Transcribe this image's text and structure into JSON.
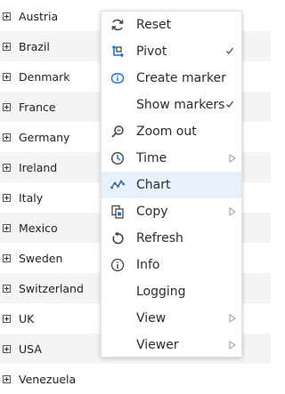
{
  "countries": [
    "Austria",
    "Brazil",
    "Denmark",
    "France",
    "Germany",
    "Ireland",
    "Italy",
    "Mexico",
    "Sweden",
    "Switzerland",
    "UK",
    "USA",
    "Venezuela"
  ],
  "menu": {
    "items": [
      {
        "label": "Reset",
        "icon": "reset-icon",
        "check": false,
        "submenu": false
      },
      {
        "label": "Pivot",
        "icon": "pivot-icon",
        "check": true,
        "submenu": false
      },
      {
        "label": "Create marker",
        "icon": "create-marker-icon",
        "check": false,
        "submenu": false
      },
      {
        "label": "Show markers",
        "icon": "",
        "check": true,
        "submenu": false
      },
      {
        "label": "Zoom out",
        "icon": "zoom-out-icon",
        "check": false,
        "submenu": false
      },
      {
        "label": "Time",
        "icon": "time-icon",
        "check": false,
        "submenu": true
      },
      {
        "label": "Chart",
        "icon": "chart-icon",
        "check": false,
        "submenu": false
      },
      {
        "label": "Copy",
        "icon": "copy-icon",
        "check": false,
        "submenu": true
      },
      {
        "label": "Refresh",
        "icon": "refresh-icon",
        "check": false,
        "submenu": false
      },
      {
        "label": "Info",
        "icon": "info-icon",
        "check": false,
        "submenu": false
      },
      {
        "label": "Logging",
        "icon": "",
        "check": false,
        "submenu": false
      },
      {
        "label": "View",
        "icon": "",
        "check": false,
        "submenu": true
      },
      {
        "label": "Viewer",
        "icon": "",
        "check": false,
        "submenu": true
      }
    ],
    "highlighted": "Chart"
  },
  "colors": {
    "accent_blue": "#1a73c9",
    "hover_bg": "#e6f1fb",
    "alt_row_bg": "#f4f4f4"
  }
}
